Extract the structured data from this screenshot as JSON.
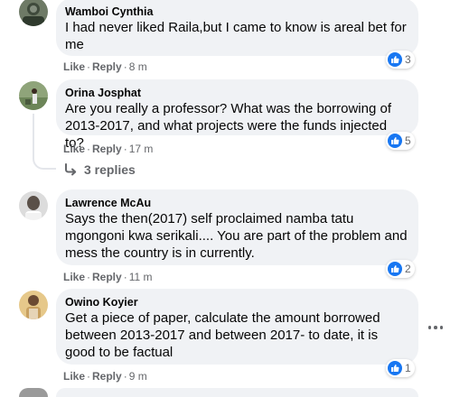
{
  "colors": {
    "bubble": "#f0f2f5",
    "meta_text": "#65676b",
    "like_blue": "#1877f2",
    "thread_line": "#e4e6eb"
  },
  "comments": [
    {
      "author": "Wamboi Cynthia",
      "text": "I had never liked Raila,but I came to know is areal bet for me",
      "like_label": "Like",
      "reply_label": "Reply",
      "time": "8 m",
      "reaction_icon": "like-icon",
      "reaction_count": "3"
    },
    {
      "author": "Orina Josphat",
      "text": "Are you really a professor? What was the borrowing of 2013-2017, and what projects were the funds injected to?",
      "like_label": "Like",
      "reply_label": "Reply",
      "time": "17 m",
      "reaction_icon": "like-icon",
      "reaction_count": "5",
      "replies_label": "3 replies"
    },
    {
      "author": "Lawrence McAu",
      "text": "Says the then(2017) self proclaimed namba tatu mgongoni kwa serikali.... You are part of the problem and mess the country is in currently.",
      "like_label": "Like",
      "reply_label": "Reply",
      "time": "11 m",
      "reaction_icon": "like-icon",
      "reaction_count": "2"
    },
    {
      "author": "Owino Koyier",
      "text": "Get a piece of paper, calculate the amount borrowed between 2013-2017 and between 2017- to date, it is good to be factual",
      "like_label": "Like",
      "reply_label": "Reply",
      "time": "9 m",
      "reaction_icon": "like-icon",
      "reaction_count": "1",
      "more_icon": "more-options-icon"
    }
  ]
}
